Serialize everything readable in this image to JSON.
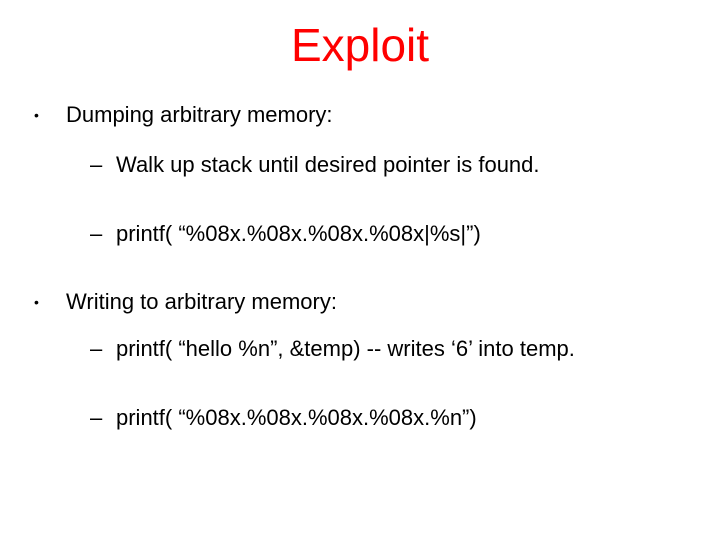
{
  "title": "Exploit",
  "bullets": [
    {
      "level": 1,
      "text": "Dumping arbitrary memory:"
    },
    {
      "level": 2,
      "text": "Walk up stack until desired pointer is found."
    },
    {
      "level": 2,
      "text": "printf( “%08x.%08x.%08x.%08x|%s|”)"
    },
    {
      "level": 1,
      "text": "Writing to arbitrary memory:"
    },
    {
      "level": 2,
      "text": "printf( “hello %n”, &temp)   --  writes ‘6’ into temp."
    },
    {
      "level": 2,
      "text": "printf( “%08x.%08x.%08x.%08x.%n”)"
    }
  ]
}
